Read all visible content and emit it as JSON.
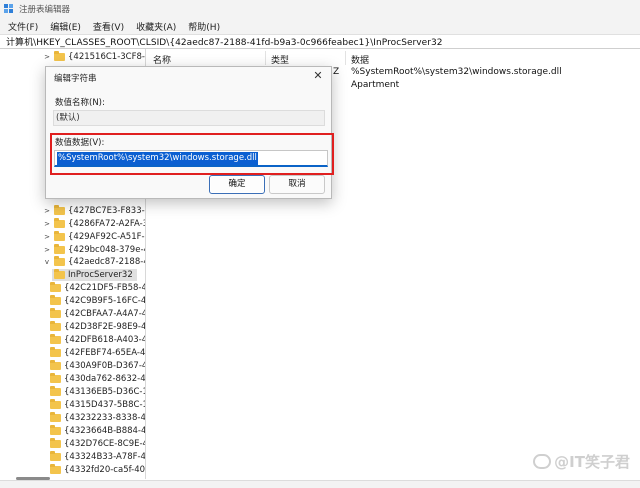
{
  "window": {
    "title": "注册表编辑器"
  },
  "menu": [
    "文件(F)",
    "编辑(E)",
    "查看(V)",
    "收藏夹(A)",
    "帮助(H)"
  ],
  "address": "计算机\\HKEY_CLASSES_ROOT\\CLSID\\{42aedc87-2188-41fd-b9a3-0c966feabec1}\\InProcServer32",
  "tree": [
    {
      "label": "{421516C1-3CF8-1",
      "expander": ">"
    },
    {
      "label": "{427BC7E3-F833-4",
      "expander": ">"
    },
    {
      "label": "{4286FA72-A2FA-3",
      "expander": ">"
    },
    {
      "label": "{429AF92C-A51F-1",
      "expander": ">"
    },
    {
      "label": "{429bc048-379e-4",
      "expander": ">"
    },
    {
      "label": "{42aedc87-2188-4",
      "expander": "v"
    },
    {
      "label": "InProcServer32",
      "expander": ""
    },
    {
      "label": "{42C21DF5-FB58-4",
      "expander": ""
    },
    {
      "label": "{42C9B9F5-16FC-4",
      "expander": ""
    },
    {
      "label": "{42CBFAA7-A4A7-4",
      "expander": ""
    },
    {
      "label": "{42D38F2E-98E9-4",
      "expander": ""
    },
    {
      "label": "{42DFB618-A403-4",
      "expander": ""
    },
    {
      "label": "{42FEBF74-65EA-4",
      "expander": ""
    },
    {
      "label": "{430A9F0B-D367-4",
      "expander": ""
    },
    {
      "label": "{430da762-8632-4",
      "expander": ""
    },
    {
      "label": "{43136EB5-D36C-1",
      "expander": ""
    },
    {
      "label": "{4315D437-5B8C-1",
      "expander": ""
    },
    {
      "label": "{43232233-8338-4",
      "expander": ""
    },
    {
      "label": "{4323664B-B884-4",
      "expander": ""
    },
    {
      "label": "{432D76CE-8C9E-4",
      "expander": ""
    },
    {
      "label": "{43324B33-A78F-4",
      "expander": ""
    },
    {
      "label": "{4332fd20-ca5f-40",
      "expander": ""
    }
  ],
  "list": {
    "columns": [
      "名称",
      "类型",
      "数据"
    ],
    "rows": [
      {
        "type_suffix": "Z",
        "data": "%SystemRoot%\\system32\\windows.storage.dll"
      },
      {
        "type_suffix": "",
        "data": "Apartment"
      }
    ]
  },
  "dialog": {
    "title": "编辑字符串",
    "name_label": "数值名称(N):",
    "name_value": "(默认)",
    "data_label": "数值数据(V):",
    "data_value": "%SystemRoot%\\system32\\windows.storage.dll",
    "ok_label": "确定",
    "cancel_label": "取消",
    "close_glyph": "✕"
  },
  "watermark": "@IT笑子君",
  "colors": {
    "highlight": "#e01f1f",
    "selection": "#0b5fd1",
    "folder": "#f3c44c"
  }
}
